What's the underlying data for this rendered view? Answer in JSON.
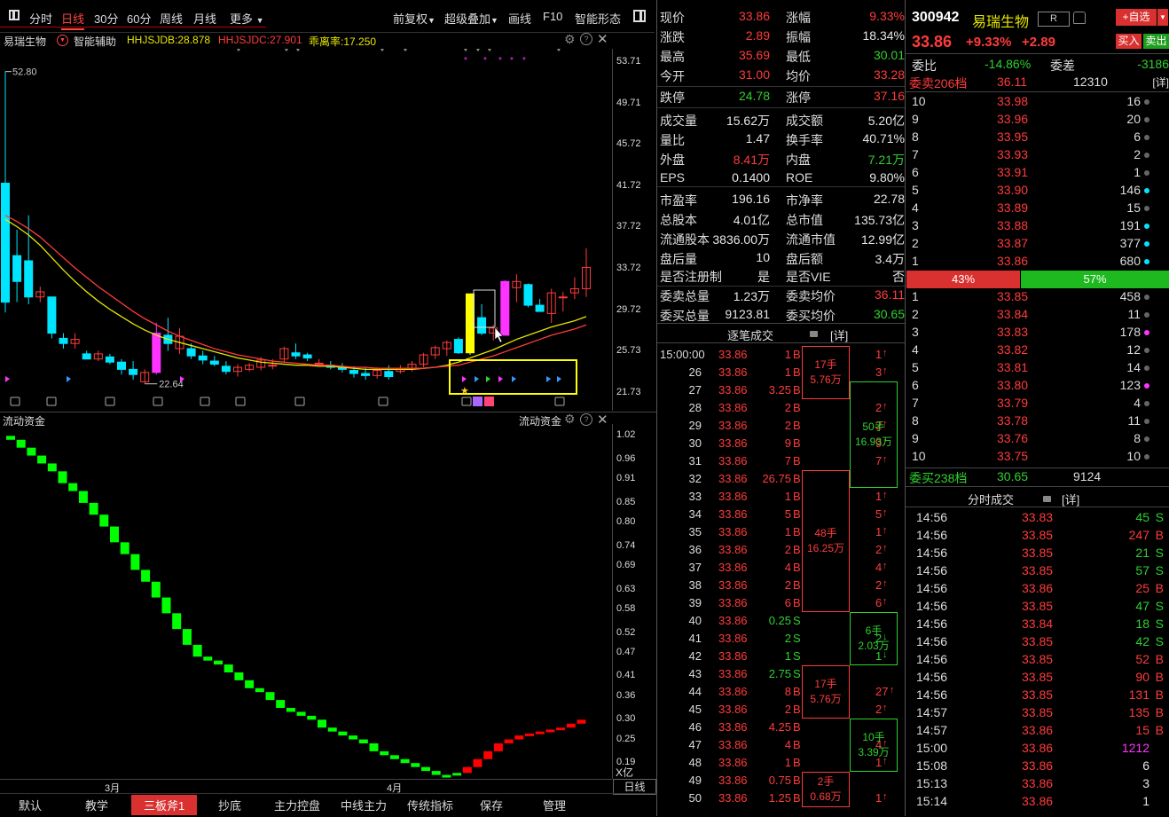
{
  "toolbar": {
    "items": [
      "分时",
      "日线",
      "30分",
      "60分",
      "周线",
      "月线",
      "更多"
    ],
    "right": [
      "前复权",
      "超级叠加",
      "画线",
      "F10",
      "智能形态"
    ]
  },
  "chart": {
    "stock_name": "易瑞生物",
    "assist": "智能辅助",
    "hhjsjdb": "HHJSJDB:28.878",
    "hhjsjdc": "HHJSJDC:27.901",
    "deviation": "乖离率:17.250",
    "high_label": "52.80",
    "low_label": "22.64",
    "y_ticks": [
      "53.71",
      "49.71",
      "45.72",
      "41.72",
      "37.72",
      "33.72",
      "29.72",
      "25.73",
      "21.73"
    ],
    "candles": [
      {
        "o": 30.5,
        "h": 52.8,
        "l": 29.5,
        "c": 42.0
      },
      {
        "o": 35.0,
        "h": 37.5,
        "l": 30.5,
        "c": 32.5
      },
      {
        "o": 34.5,
        "h": 38.9,
        "l": 30.3,
        "c": 31.0
      },
      {
        "o": 31.0,
        "h": 32.0,
        "l": 30.5,
        "c": 31.5
      },
      {
        "o": 31.0,
        "h": 31.0,
        "l": 27.0,
        "c": 27.5
      },
      {
        "o": 27.0,
        "h": 27.5,
        "l": 26.0,
        "c": 26.5
      },
      {
        "o": 26.5,
        "h": 27.5,
        "l": 26.0,
        "c": 26.9
      },
      {
        "o": 25.5,
        "h": 25.8,
        "l": 25.0,
        "c": 25.0
      },
      {
        "o": 25.0,
        "h": 25.8,
        "l": 24.8,
        "c": 25.5
      },
      {
        "o": 25.2,
        "h": 25.5,
        "l": 24.5,
        "c": 24.7
      },
      {
        "o": 24.7,
        "h": 25.0,
        "l": 23.5,
        "c": 24.0
      },
      {
        "o": 24.0,
        "h": 24.8,
        "l": 23.0,
        "c": 23.5
      },
      {
        "o": 22.8,
        "h": 24.0,
        "l": 22.6,
        "c": 23.7
      },
      {
        "o": 23.7,
        "h": 28.5,
        "l": 23.5,
        "c": 27.5
      },
      {
        "o": 27.3,
        "h": 29.0,
        "l": 25.8,
        "c": 26.5
      },
      {
        "o": 26.0,
        "h": 28.0,
        "l": 25.5,
        "c": 27.2
      },
      {
        "o": 26.0,
        "h": 26.5,
        "l": 25.0,
        "c": 25.3
      },
      {
        "o": 25.3,
        "h": 25.8,
        "l": 24.5,
        "c": 24.9
      },
      {
        "o": 24.8,
        "h": 25.3,
        "l": 24.3,
        "c": 24.5
      },
      {
        "o": 24.3,
        "h": 24.8,
        "l": 23.5,
        "c": 23.8
      },
      {
        "o": 23.8,
        "h": 24.5,
        "l": 23.3,
        "c": 24.2
      },
      {
        "o": 24.0,
        "h": 24.6,
        "l": 23.8,
        "c": 24.4
      },
      {
        "o": 24.2,
        "h": 25.2,
        "l": 23.9,
        "c": 24.9
      },
      {
        "o": 24.4,
        "h": 25.0,
        "l": 24.0,
        "c": 24.4
      },
      {
        "o": 25.0,
        "h": 26.2,
        "l": 24.7,
        "c": 26.0
      },
      {
        "o": 25.6,
        "h": 26.5,
        "l": 25.0,
        "c": 25.3
      },
      {
        "o": 25.4,
        "h": 25.6,
        "l": 24.8,
        "c": 25.1
      },
      {
        "o": 24.6,
        "h": 25.0,
        "l": 24.3,
        "c": 24.6
      },
      {
        "o": 24.4,
        "h": 24.8,
        "l": 24.0,
        "c": 24.2
      },
      {
        "o": 24.2,
        "h": 24.6,
        "l": 23.7,
        "c": 24.0
      },
      {
        "o": 23.9,
        "h": 24.3,
        "l": 23.2,
        "c": 23.6
      },
      {
        "o": 23.6,
        "h": 24.2,
        "l": 23.0,
        "c": 23.4
      },
      {
        "o": 23.4,
        "h": 24.2,
        "l": 23.1,
        "c": 23.9
      },
      {
        "o": 23.8,
        "h": 24.4,
        "l": 23.0,
        "c": 23.3
      },
      {
        "o": 23.8,
        "h": 24.4,
        "l": 23.6,
        "c": 24.1
      },
      {
        "o": 24.1,
        "h": 24.8,
        "l": 23.8,
        "c": 24.5
      },
      {
        "o": 24.5,
        "h": 25.6,
        "l": 24.2,
        "c": 25.4
      },
      {
        "o": 25.4,
        "h": 26.3,
        "l": 25.0,
        "c": 26.1
      },
      {
        "o": 26.0,
        "h": 26.8,
        "l": 25.3,
        "c": 26.6
      },
      {
        "o": 26.9,
        "h": 27.1,
        "l": 25.5,
        "c": 25.6
      },
      {
        "o": 25.6,
        "h": 31.3,
        "l": 25.4,
        "c": 31.3
      },
      {
        "o": 29.0,
        "h": 30.3,
        "l": 27.3,
        "c": 27.5
      },
      {
        "o": 27.5,
        "h": 28.3,
        "l": 26.8,
        "c": 28.0
      },
      {
        "o": 27.3,
        "h": 32.6,
        "l": 27.3,
        "c": 32.5
      },
      {
        "o": 31.9,
        "h": 33.2,
        "l": 30.5,
        "c": 32.5
      },
      {
        "o": 32.2,
        "h": 32.3,
        "l": 30.0,
        "c": 30.2
      },
      {
        "o": 30.2,
        "h": 30.8,
        "l": 29.6,
        "c": 29.6
      },
      {
        "o": 29.4,
        "h": 31.8,
        "l": 28.5,
        "c": 31.4
      },
      {
        "o": 31.0,
        "h": 31.5,
        "l": 29.6,
        "c": 31.0
      },
      {
        "o": 31.4,
        "h": 32.9,
        "l": 30.8,
        "c": 31.8
      },
      {
        "o": 31.8,
        "h": 35.7,
        "l": 31.0,
        "c": 33.86
      }
    ],
    "candle_colors": {
      "up": "#ff3b3b",
      "down": "#00e5ff",
      "limit_up": "#ff33ff",
      "special": "#ffff00"
    },
    "ma1": [
      38.5,
      37.8,
      37.0,
      36.0,
      34.8,
      33.6,
      32.5,
      31.5,
      30.6,
      29.8,
      29.1,
      28.4,
      27.8,
      27.3,
      26.9,
      26.6,
      26.3,
      26.0,
      25.7,
      25.4,
      25.1,
      24.9,
      24.7,
      24.6,
      24.5,
      24.4,
      24.4,
      24.3,
      24.3,
      24.2,
      24.1,
      24.0,
      24.0,
      24.0,
      24.0,
      24.0,
      24.1,
      24.2,
      24.4,
      24.7,
      25.1,
      25.5,
      25.9,
      26.4,
      26.9,
      27.3,
      27.7,
      28.1,
      28.4,
      28.7,
      29.1
    ],
    "ma2": [
      38.9,
      38.3,
      37.6,
      36.8,
      35.8,
      34.8,
      33.8,
      32.9,
      32.0,
      31.2,
      30.4,
      29.6,
      28.9,
      28.3,
      27.7,
      27.2,
      26.8,
      26.4,
      26.0,
      25.7,
      25.4,
      25.2,
      25.0,
      24.8,
      24.7,
      24.6,
      24.5,
      24.4,
      24.4,
      24.3,
      24.2,
      24.2,
      24.1,
      24.1,
      24.1,
      24.1,
      24.1,
      24.2,
      24.3,
      24.4,
      24.7,
      25.0,
      25.3,
      25.7,
      26.1,
      26.5,
      26.9,
      27.3,
      27.6,
      27.9,
      28.3
    ],
    "x_labels": [
      "3月",
      "4月"
    ]
  },
  "flow": {
    "title": "流动资金",
    "title_right": "流动资金",
    "y_ticks": [
      "1.02",
      "0.96",
      "0.91",
      "0.85",
      "0.80",
      "0.74",
      "0.69",
      "0.63",
      "0.58",
      "0.52",
      "0.47",
      "0.41",
      "0.36",
      "0.30",
      "0.25",
      "0.19"
    ],
    "unit": "X亿",
    "period": "日线",
    "values": [
      1.02,
      1.01,
      0.99,
      0.97,
      0.95,
      0.93,
      0.9,
      0.88,
      0.85,
      0.82,
      0.79,
      0.75,
      0.72,
      0.68,
      0.65,
      0.61,
      0.57,
      0.53,
      0.49,
      0.46,
      0.45,
      0.44,
      0.42,
      0.4,
      0.38,
      0.37,
      0.35,
      0.33,
      0.32,
      0.31,
      0.3,
      0.28,
      0.27,
      0.26,
      0.25,
      0.24,
      0.22,
      0.21,
      0.2,
      0.19,
      0.18,
      0.17,
      0.16,
      0.16,
      0.165,
      0.18,
      0.2,
      0.22,
      0.24,
      0.25,
      0.26,
      0.265,
      0.27,
      0.275,
      0.28,
      0.29,
      0.3
    ],
    "colors": {
      "down": "#00ff00",
      "up": "#ff0000"
    },
    "turn_index": 44
  },
  "bottom_tabs": [
    "默认",
    "教学",
    "三板斧1",
    "抄底",
    "主力控盘",
    "中线主力",
    "传统指标",
    "保存",
    "管理"
  ],
  "quote": [
    {
      "k1": "现价",
      "v1": "33.86",
      "c1": "red",
      "k2": "涨幅",
      "v2": "9.33%",
      "c2": "red"
    },
    {
      "k1": "涨跌",
      "v1": "2.89",
      "c1": "red",
      "k2": "振幅",
      "v2": "18.34%",
      "c2": "white"
    },
    {
      "k1": "最高",
      "v1": "35.69",
      "c1": "red",
      "k2": "最低",
      "v2": "30.01",
      "c2": "green"
    },
    {
      "k1": "今开",
      "v1": "31.00",
      "c1": "red",
      "k2": "均价",
      "v2": "33.28",
      "c2": "red"
    },
    {
      "k1": "跌停",
      "v1": "24.78",
      "c1": "green",
      "k2": "涨停",
      "v2": "37.16",
      "c2": "red"
    },
    {
      "k1": "成交量",
      "v1": "15.62万",
      "c1": "white",
      "k2": "成交额",
      "v2": "5.20亿",
      "c2": "white"
    },
    {
      "k1": "量比",
      "v1": "1.47",
      "c1": "white",
      "k2": "换手率",
      "v2": "40.71%",
      "c2": "white"
    },
    {
      "k1": "外盘",
      "v1": "8.41万",
      "c1": "red",
      "k2": "内盘",
      "v2": "7.21万",
      "c2": "green"
    },
    {
      "k1": "EPS",
      "v1": "0.1400",
      "c1": "white",
      "k2": "ROE",
      "v2": "9.80%",
      "c2": "white"
    },
    {
      "k1": "市盈率",
      "v1": "196.16",
      "c1": "white",
      "k2": "市净率",
      "v2": "22.78",
      "c2": "white"
    },
    {
      "k1": "总股本",
      "v1": "4.01亿",
      "c1": "white",
      "k2": "总市值",
      "v2": "135.73亿",
      "c2": "white"
    },
    {
      "k1": "流通股本",
      "v1": "3836.00万",
      "c1": "white",
      "k2": "流通市值",
      "v2": "12.99亿",
      "c2": "white"
    },
    {
      "k1": "盘后量",
      "v1": "10",
      "c1": "white",
      "k2": "盘后额",
      "v2": "3.4万",
      "c2": "white"
    },
    {
      "k1": "是否注册制",
      "v1": "是",
      "c1": "white",
      "k2": "是否VIE",
      "v2": "否",
      "c2": "white"
    },
    {
      "k1": "委卖总量",
      "v1": "1.23万",
      "c1": "white",
      "k2": "委卖均价",
      "v2": "36.11",
      "c2": "red"
    },
    {
      "k1": "委买总量",
      "v1": "9123.81",
      "c1": "white",
      "k2": "委买均价",
      "v2": "30.65",
      "c2": "green"
    }
  ],
  "ticks_header": {
    "title": "逐笔成交",
    "detail": "[详]"
  },
  "ticks": [
    {
      "t": "15:00:00",
      "p": "33.86",
      "v": "1",
      "s": "B",
      "a": "1"
    },
    {
      "t": "26",
      "p": "33.86",
      "v": "1",
      "s": "B",
      "a": "3"
    },
    {
      "t": "27",
      "p": "33.86",
      "v": "3.25",
      "s": "B",
      "a": ""
    },
    {
      "t": "28",
      "p": "33.86",
      "v": "2",
      "s": "B",
      "a": "2"
    },
    {
      "t": "29",
      "p": "33.86",
      "v": "2",
      "s": "B",
      "a": "2"
    },
    {
      "t": "30",
      "p": "33.86",
      "v": "9",
      "s": "B",
      "a": "9"
    },
    {
      "t": "31",
      "p": "33.86",
      "v": "7",
      "s": "B",
      "a": "7"
    },
    {
      "t": "32",
      "p": "33.86",
      "v": "26.75",
      "s": "B",
      "a": ""
    },
    {
      "t": "33",
      "p": "33.86",
      "v": "1",
      "s": "B",
      "a": "1"
    },
    {
      "t": "34",
      "p": "33.86",
      "v": "5",
      "s": "B",
      "a": "5"
    },
    {
      "t": "35",
      "p": "33.86",
      "v": "1",
      "s": "B",
      "a": "1"
    },
    {
      "t": "36",
      "p": "33.86",
      "v": "2",
      "s": "B",
      "a": "2"
    },
    {
      "t": "37",
      "p": "33.86",
      "v": "4",
      "s": "B",
      "a": "4"
    },
    {
      "t": "38",
      "p": "33.86",
      "v": "2",
      "s": "B",
      "a": "2"
    },
    {
      "t": "39",
      "p": "33.86",
      "v": "6",
      "s": "B",
      "a": "6"
    },
    {
      "t": "40",
      "p": "33.86",
      "v": "0.25",
      "s": "S",
      "a": ""
    },
    {
      "t": "41",
      "p": "33.86",
      "v": "2",
      "s": "S",
      "a": "2"
    },
    {
      "t": "42",
      "p": "33.86",
      "v": "1",
      "s": "S",
      "a": "1"
    },
    {
      "t": "43",
      "p": "33.86",
      "v": "2.75",
      "s": "S",
      "a": ""
    },
    {
      "t": "44",
      "p": "33.86",
      "v": "8",
      "s": "B",
      "a": "27"
    },
    {
      "t": "45",
      "p": "33.86",
      "v": "2",
      "s": "B",
      "a": "2"
    },
    {
      "t": "46",
      "p": "33.86",
      "v": "4.25",
      "s": "B",
      "a": ""
    },
    {
      "t": "47",
      "p": "33.86",
      "v": "4",
      "s": "B",
      "a": "4"
    },
    {
      "t": "48",
      "p": "33.86",
      "v": "1",
      "s": "B",
      "a": "1"
    },
    {
      "t": "49",
      "p": "33.86",
      "v": "0.75",
      "s": "B",
      "a": ""
    },
    {
      "t": "50",
      "p": "33.86",
      "v": "1.25",
      "s": "B",
      "a": "1"
    }
  ],
  "tick_groups": [
    {
      "l1": "17手",
      "l2": "5.76万",
      "c": "red"
    },
    {
      "l1": "50手",
      "l2": "16.93万",
      "c": "green"
    },
    {
      "l1": "48手",
      "l2": "16.25万",
      "c": "red"
    },
    {
      "l1": "6手",
      "l2": "2.03万",
      "c": "green"
    },
    {
      "l1": "17手",
      "l2": "5.76万",
      "c": "red"
    },
    {
      "l1": "10手",
      "l2": "3.39万",
      "c": "green"
    },
    {
      "l1": "2手",
      "l2": "0.68万",
      "c": "red"
    }
  ],
  "stock_header": {
    "code": "300942",
    "name": "易瑞生物",
    "r": "R",
    "price": "33.86",
    "pct": "+9.33%",
    "chg": "+2.89",
    "add_btn": "+自选",
    "buy": "买入",
    "sell": "卖出"
  },
  "orderbook": {
    "weibi_label": "委比",
    "weibi": "-14.86%",
    "weicha_label": "委差",
    "weicha": "-3186",
    "sell_total_label": "委卖206档",
    "sell_total_price": "36.11",
    "sell_total_vol": "12310",
    "detail": "[详]",
    "asks": [
      {
        "n": "10",
        "p": "33.98",
        "v": "16",
        "d": "#666"
      },
      {
        "n": "9",
        "p": "33.96",
        "v": "20",
        "d": "#666"
      },
      {
        "n": "8",
        "p": "33.95",
        "v": "6",
        "d": "#666"
      },
      {
        "n": "7",
        "p": "33.93",
        "v": "2",
        "d": "#666"
      },
      {
        "n": "6",
        "p": "33.91",
        "v": "1",
        "d": "#666"
      },
      {
        "n": "5",
        "p": "33.90",
        "v": "146",
        "d": "#00e5ff"
      },
      {
        "n": "4",
        "p": "33.89",
        "v": "15",
        "d": "#666"
      },
      {
        "n": "3",
        "p": "33.88",
        "v": "191",
        "d": "#00e5ff"
      },
      {
        "n": "2",
        "p": "33.87",
        "v": "377",
        "d": "#00e5ff"
      },
      {
        "n": "1",
        "p": "33.86",
        "v": "680",
        "d": "#00e5ff"
      }
    ],
    "sell_pct": "43%",
    "buy_pct": "57%",
    "bids": [
      {
        "n": "1",
        "p": "33.85",
        "v": "458",
        "d": "#666"
      },
      {
        "n": "2",
        "p": "33.84",
        "v": "11",
        "d": "#666"
      },
      {
        "n": "3",
        "p": "33.83",
        "v": "178",
        "d": "#ff33ff"
      },
      {
        "n": "4",
        "p": "33.82",
        "v": "12",
        "d": "#666"
      },
      {
        "n": "5",
        "p": "33.81",
        "v": "14",
        "d": "#666"
      },
      {
        "n": "6",
        "p": "33.80",
        "v": "123",
        "d": "#ff33ff"
      },
      {
        "n": "7",
        "p": "33.79",
        "v": "4",
        "d": "#666"
      },
      {
        "n": "8",
        "p": "33.78",
        "v": "11",
        "d": "#666"
      },
      {
        "n": "9",
        "p": "33.76",
        "v": "8",
        "d": "#666"
      },
      {
        "n": "10",
        "p": "33.75",
        "v": "10",
        "d": "#666"
      }
    ],
    "buy_total_label": "委买238档",
    "buy_total_price": "30.65",
    "buy_total_vol": "9124"
  },
  "timesales_header": {
    "title": "分时成交",
    "detail": "[详]"
  },
  "timesales": [
    {
      "t": "14:56",
      "p": "33.83",
      "v": "45",
      "s": "S",
      "c": "green"
    },
    {
      "t": "14:56",
      "p": "33.85",
      "v": "247",
      "s": "B",
      "c": "red"
    },
    {
      "t": "14:56",
      "p": "33.85",
      "v": "21",
      "s": "S",
      "c": "green"
    },
    {
      "t": "14:56",
      "p": "33.85",
      "v": "57",
      "s": "S",
      "c": "green"
    },
    {
      "t": "14:56",
      "p": "33.86",
      "v": "25",
      "s": "B",
      "c": "red"
    },
    {
      "t": "14:56",
      "p": "33.85",
      "v": "47",
      "s": "S",
      "c": "green"
    },
    {
      "t": "14:56",
      "p": "33.84",
      "v": "18",
      "s": "S",
      "c": "green"
    },
    {
      "t": "14:56",
      "p": "33.85",
      "v": "42",
      "s": "S",
      "c": "green"
    },
    {
      "t": "14:56",
      "p": "33.85",
      "v": "52",
      "s": "B",
      "c": "red"
    },
    {
      "t": "14:56",
      "p": "33.85",
      "v": "90",
      "s": "B",
      "c": "red"
    },
    {
      "t": "14:56",
      "p": "33.85",
      "v": "131",
      "s": "B",
      "c": "red"
    },
    {
      "t": "14:57",
      "p": "33.85",
      "v": "135",
      "s": "B",
      "c": "red"
    },
    {
      "t": "14:57",
      "p": "33.86",
      "v": "15",
      "s": "B",
      "c": "red"
    },
    {
      "t": "15:00",
      "p": "33.86",
      "v": "1212",
      "s": "",
      "c": "magenta"
    },
    {
      "t": "15:08",
      "p": "33.86",
      "v": "6",
      "s": "",
      "c": "white"
    },
    {
      "t": "15:13",
      "p": "33.86",
      "v": "3",
      "s": "",
      "c": "white"
    },
    {
      "t": "15:14",
      "p": "33.86",
      "v": "1",
      "s": "",
      "c": "white"
    }
  ]
}
